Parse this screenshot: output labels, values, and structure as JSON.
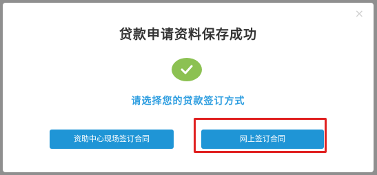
{
  "dialog": {
    "close_symbol": "×",
    "title": "贷款申请资料保存成功",
    "success_icon": "check-icon",
    "subtitle": "请选择您的贷款签订方式",
    "buttons": {
      "onsite_label": "资助中心现场签订合同",
      "online_label": "网上签订合同"
    }
  },
  "colors": {
    "accent": "#1f95d6",
    "success": "#8cc152",
    "highlight": "#e02020",
    "overlay": "#8f8f8f"
  }
}
